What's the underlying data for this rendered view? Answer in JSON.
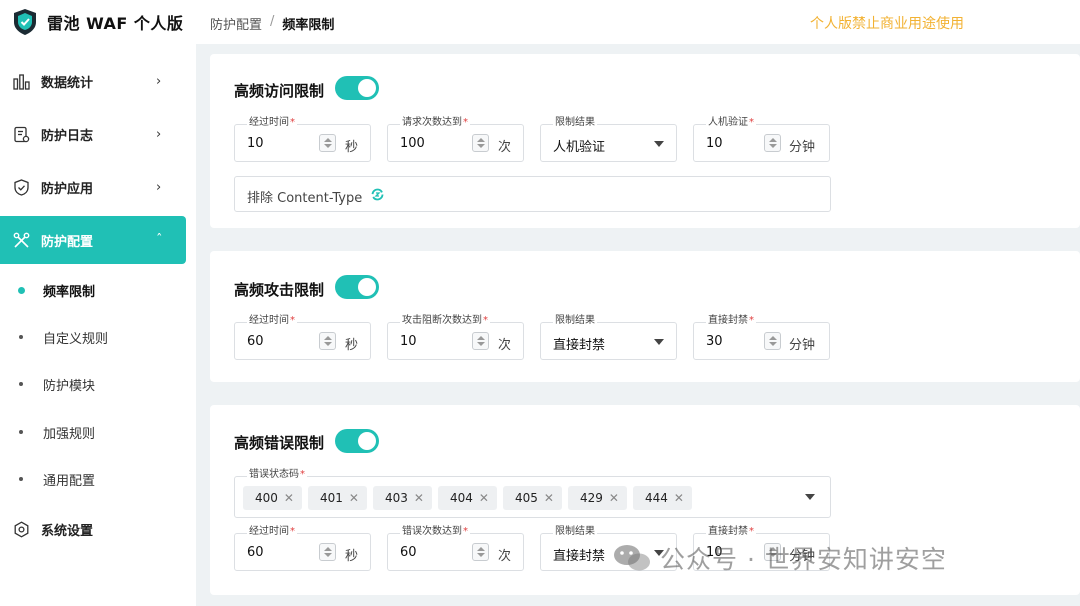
{
  "brand": {
    "name": "雷池 WAF 个人版"
  },
  "breadcrumb": {
    "parent": "防护配置",
    "separator": "/",
    "current": "频率限制"
  },
  "notice": "个人版禁止商业用途使用",
  "sidebar": {
    "items": [
      {
        "label": "数据统计",
        "icon": "bar-chart-icon"
      },
      {
        "label": "防护日志",
        "icon": "log-icon"
      },
      {
        "label": "防护应用",
        "icon": "shield-icon"
      },
      {
        "label": "防护配置",
        "icon": "tools-icon"
      },
      {
        "label": "系统设置",
        "icon": "gear-icon"
      }
    ],
    "sub_items": [
      {
        "label": "频率限制"
      },
      {
        "label": "自定义规则"
      },
      {
        "label": "防护模块"
      },
      {
        "label": "加强规则"
      },
      {
        "label": "通用配置"
      }
    ]
  },
  "cards": {
    "access": {
      "title": "高频访问限制",
      "enabled": true,
      "fields": {
        "period": {
          "label": "经过时间",
          "value": "10",
          "unit": "秒"
        },
        "count": {
          "label": "请求次数达到",
          "value": "100",
          "unit": "次"
        },
        "result": {
          "label": "限制结果",
          "value": "人机验证"
        },
        "verify": {
          "label": "人机验证",
          "value": "10",
          "unit": "分钟"
        }
      },
      "exclude_label": "排除 Content-Type"
    },
    "attack": {
      "title": "高频攻击限制",
      "enabled": true,
      "fields": {
        "period": {
          "label": "经过时间",
          "value": "60",
          "unit": "秒"
        },
        "count": {
          "label": "攻击阻断次数达到",
          "value": "10",
          "unit": "次"
        },
        "result": {
          "label": "限制结果",
          "value": "直接封禁"
        },
        "ban": {
          "label": "直接封禁",
          "value": "30",
          "unit": "分钟"
        }
      }
    },
    "error": {
      "title": "高频错误限制",
      "enabled": true,
      "status_label": "错误状态码",
      "codes": [
        "400",
        "401",
        "403",
        "404",
        "405",
        "429",
        "444"
      ],
      "fields": {
        "period": {
          "label": "经过时间",
          "value": "60",
          "unit": "秒"
        },
        "count": {
          "label": "错误次数达到",
          "value": "60",
          "unit": "次"
        },
        "result": {
          "label": "限制结果",
          "value": "直接封禁"
        },
        "ban": {
          "label": "直接封禁",
          "value": "10",
          "unit": "分钟"
        }
      }
    }
  },
  "watermark": "公众号 · 世界安知讲安空",
  "colors": {
    "accent": "#20c0b5",
    "notice": "#f2b233",
    "required": "#e04040"
  }
}
